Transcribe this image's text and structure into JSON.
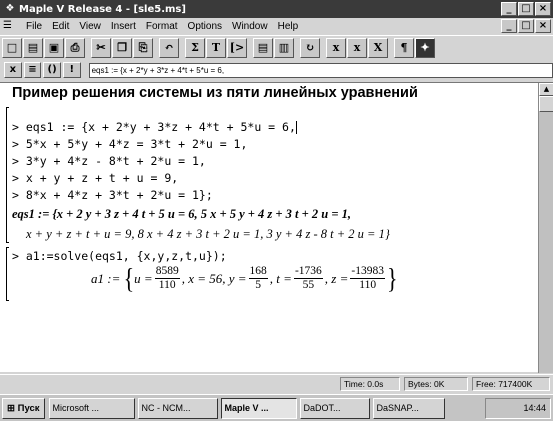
{
  "window": {
    "title": "Maple V Release 4 - [sle5.ms]",
    "controls": [
      "_",
      "□",
      "×"
    ]
  },
  "menu": {
    "items": [
      "File",
      "Edit",
      "View",
      "Insert",
      "Format",
      "Options",
      "Window",
      "Help"
    ],
    "doc_controls": [
      "_",
      "□",
      "×"
    ]
  },
  "toolbar": {
    "buttons": [
      {
        "icon": "new-file-icon",
        "glyph": "□"
      },
      {
        "icon": "open-file-icon",
        "glyph": "▤"
      },
      {
        "icon": "save-icon",
        "glyph": "▣"
      },
      {
        "icon": "print-icon",
        "glyph": "⎙"
      },
      {
        "icon": "cut-icon",
        "glyph": "✂"
      },
      {
        "icon": "copy-icon",
        "glyph": "❐"
      },
      {
        "icon": "paste-icon",
        "glyph": "⎘"
      },
      {
        "icon": "undo-icon",
        "glyph": "↶"
      },
      {
        "icon": "sum-icon",
        "glyph": "Σ"
      },
      {
        "icon": "text-icon",
        "glyph": "T"
      },
      {
        "icon": "prompt-icon",
        "glyph": "[>"
      },
      {
        "icon": "collapse-icon",
        "glyph": "▤"
      },
      {
        "icon": "expand-icon",
        "glyph": "▥"
      },
      {
        "icon": "restart-icon",
        "glyph": "↻"
      },
      {
        "icon": "zoom-x-icon",
        "glyph": "x"
      },
      {
        "icon": "zoom-x2-icon",
        "glyph": "x"
      },
      {
        "icon": "zoom-x3-icon",
        "glyph": "X"
      },
      {
        "icon": "paragraph-icon",
        "glyph": "¶"
      },
      {
        "icon": "stop-icon",
        "glyph": "✦"
      }
    ]
  },
  "inputbar": {
    "buttons": [
      "x",
      "≡",
      "()",
      "!"
    ],
    "command": "eqs1 := {x + 2*y + 3*z + 4*t + 5*u = 6,"
  },
  "document": {
    "heading": "Пример решения системы из пяти линейных уравнений",
    "input_lines": [
      "> eqs1 := {x + 2*y + 3*z + 4*t + 5*u = 6,",
      "> 5*x + 5*y + 4*z = 3*t + 2*u = 1,",
      "> 3*y + 4*z - 8*t + 2*u = 1,",
      "> x + y + z + t + u = 9,",
      "> 8*x + 4*z + 3*t + 2*u = 1};"
    ],
    "output_line1": "eqs1 := {x + 2 y + 3 z + 4 t + 5 u = 6, 5 x + 5 y + 4 z + 3 t + 2 u = 1,",
    "output_line2": "x + y + z + t + u = 9, 8 x + 4 z + 3 t + 2 u = 1, 3 y + 4 z - 8 t + 2 u = 1}",
    "solve_line": "> a1:=solve(eqs1, {x,y,z,t,u});",
    "result": {
      "label": "a1 :=",
      "open": "{",
      "close": "}",
      "u_var": "u =",
      "u_num": "8589",
      "u_den": "110",
      "x_part": ", x = 56, y =",
      "y_num": "168",
      "y_den": "5",
      "t_part": ", t =",
      "t_num": "-1736",
      "t_den": "55",
      "z_part": ", z =",
      "z_num": "-13983",
      "z_den": "110"
    }
  },
  "status": {
    "time": "Time: 0.0s",
    "bytes": "Bytes: 0K",
    "free": "Free: 717400K"
  },
  "taskbar": {
    "start": "Пуск",
    "tasks": [
      "Microsoft ...",
      "NC - NCM...",
      "Maple V ...",
      "DaDOT...",
      "DaSNAP..."
    ],
    "clock": "14:44"
  }
}
